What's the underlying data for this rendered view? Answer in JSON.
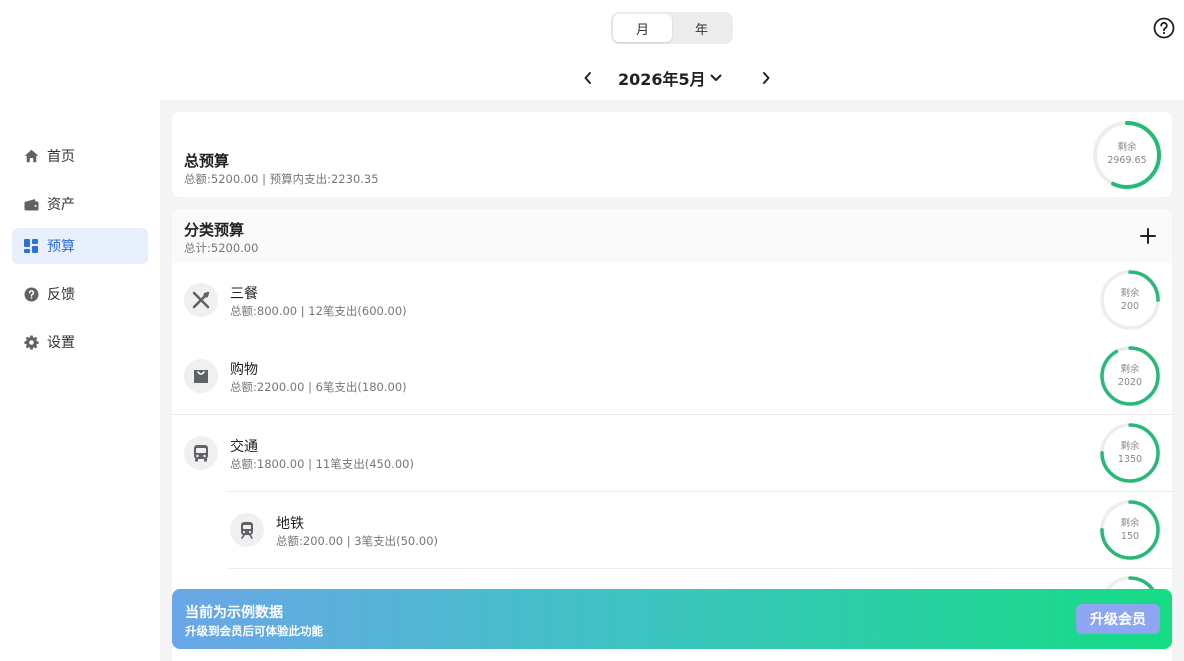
{
  "header": {
    "period_tabs": [
      {
        "label": "月",
        "active": true
      },
      {
        "label": "年",
        "active": false
      }
    ],
    "month_label": "2026年5月",
    "help_icon": "question-circle-icon"
  },
  "sidebar": {
    "items": [
      {
        "label": "首页",
        "icon": "home-icon",
        "active": false
      },
      {
        "label": "资产",
        "icon": "wallet-icon",
        "active": false
      },
      {
        "label": "预算",
        "icon": "dashboard-icon",
        "active": true
      },
      {
        "label": "反馈",
        "icon": "question-icon",
        "active": false
      },
      {
        "label": "设置",
        "icon": "gear-icon",
        "active": false
      }
    ]
  },
  "total_budget": {
    "title": "总预算",
    "subtitle": "总额:5200.00 | 预算内支出:2230.35",
    "ring_label": "剩余",
    "ring_value": "2969.65",
    "remaining_fraction": 0.571
  },
  "category_budget": {
    "title": "分类预算",
    "subtitle": "总计:5200.00",
    "items": [
      {
        "name": "三餐",
        "info": "总额:800.00 | 12笔支出(600.00)",
        "icon": "utensils-icon",
        "ring_label": "剩余",
        "ring_value": "200",
        "remaining_fraction": 0.25,
        "sub": false
      },
      {
        "name": "购物",
        "info": "总额:2200.00 | 6笔支出(180.00)",
        "icon": "shopping-bag-icon",
        "ring_label": "剩余",
        "ring_value": "2020",
        "remaining_fraction": 0.918,
        "sub": false
      },
      {
        "name": "交通",
        "info": "总额:1800.00 | 11笔支出(450.00)",
        "icon": "bus-icon",
        "ring_label": "剩余",
        "ring_value": "1350",
        "remaining_fraction": 0.75,
        "sub": false
      },
      {
        "name": "地铁",
        "info": "总额:200.00 | 3笔支出(50.00)",
        "icon": "train-icon",
        "ring_label": "剩余",
        "ring_value": "150",
        "remaining_fraction": 0.75,
        "sub": true
      }
    ]
  },
  "banner": {
    "title": "当前为示例数据",
    "subtitle": "升级到会员后可体验此功能",
    "button_label": "升级会员"
  },
  "colors": {
    "accent": "#2f6fd6",
    "ring_green": "#27b978",
    "ring_track": "#ededed"
  }
}
